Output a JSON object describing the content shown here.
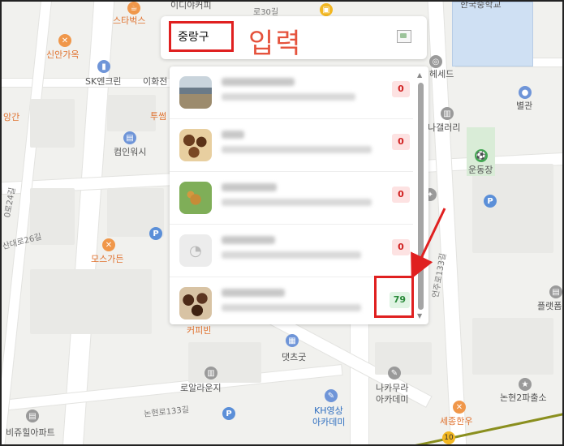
{
  "search": {
    "value": "중랑구"
  },
  "annotation": {
    "input_label": "입력"
  },
  "results": [
    {
      "thumb": "shop",
      "score": "0",
      "status": "zero"
    },
    {
      "thumb": "cookie",
      "score": "0",
      "status": "zero"
    },
    {
      "thumb": "plant",
      "score": "0",
      "status": "zero"
    },
    {
      "thumb": "placeholder",
      "thumb_icon": "cookie-icon",
      "score": "0",
      "status": "zero"
    },
    {
      "thumb": "cookie2",
      "score": "79",
      "status": "good"
    }
  ],
  "map": {
    "labels": {
      "starbucks": "스타벅스",
      "olive_young_top": "이디야커피",
      "road_30": "로30길",
      "sinan": "신안가옥",
      "sk": "SK엔크린",
      "ihwa": "이화전",
      "tuseol": "투썸",
      "sanggan": "앙간",
      "compwash": "컴인워시",
      "road_24": "0로24길",
      "road_26": "산대로26길",
      "mosgarden": "모스가든",
      "coffee_bin": "커피빈",
      "dachgut": "댓츠굿",
      "rolla": "로알라운지",
      "road_133": "논현로133길",
      "bijuhill": "비쥬힐아파트",
      "kh": "KH영상",
      "kh2": "아카데미",
      "nakamura": "나카무라",
      "nakamura2": "아카데미",
      "sejong": "세종한우",
      "nonhyun": "논현2파출소",
      "gallery": "나갤러리",
      "hesed": "헤세드",
      "byeolgwan": "별관",
      "stadium": "운동장",
      "eonju": "언주로133길",
      "flatplus": "플랫폼",
      "univ": "한국중학교"
    },
    "station_badge": "10"
  },
  "colors": {
    "accent_red": "#e02020",
    "good_green": "#2a8a3a",
    "zero_red": "#d02020"
  }
}
